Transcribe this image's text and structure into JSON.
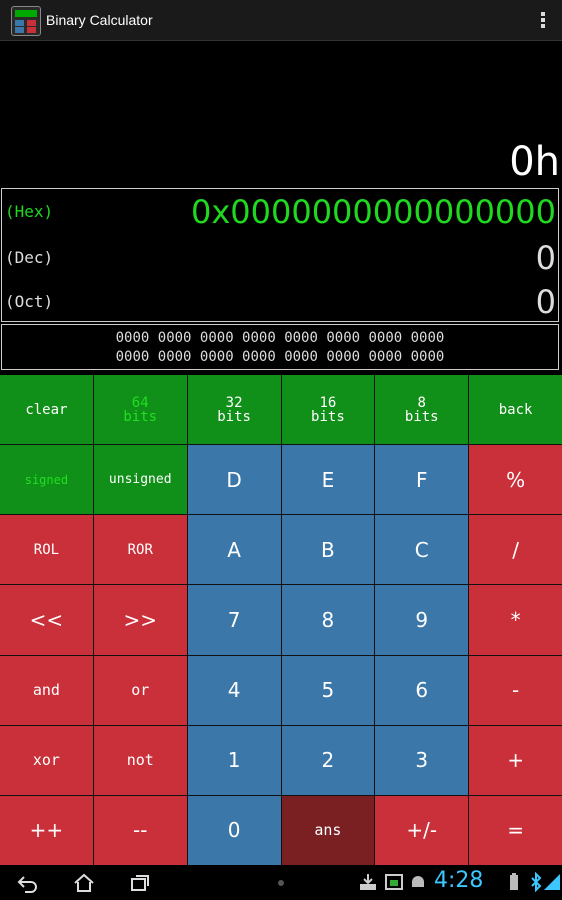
{
  "app": {
    "title": "Binary Calculator",
    "icon": "binary-calculator-app-icon"
  },
  "display": {
    "answer": "0h",
    "hex_label": "(Hex)",
    "hex_value": "0x0000000000000000",
    "dec_label": "(Dec)",
    "dec_value": "0",
    "oct_label": "(Oct)",
    "oct_value": "0",
    "bits_line1": "0000 0000 0000 0000 0000 0000 0000 0000",
    "bits_line2": "0000 0000 0000 0000 0000 0000 0000 0000"
  },
  "keys": {
    "clear": "clear",
    "b64_top": "64",
    "b64_bottom": "bits",
    "b32_top": "32",
    "b32_bottom": "bits",
    "b16_top": "16",
    "b16_bottom": "bits",
    "b8_top": "8",
    "b8_bottom": "bits",
    "back": "back",
    "signed": "signed",
    "unsigned": "unsigned",
    "D": "D",
    "E": "E",
    "F": "F",
    "mod": "%",
    "rol": "ROL",
    "ror": "ROR",
    "A": "A",
    "B": "B",
    "C": "C",
    "div": "/",
    "shl": "<<",
    "shr": ">>",
    "n7": "7",
    "n8": "8",
    "n9": "9",
    "mul": "*",
    "and": "and",
    "or": "or",
    "n4": "4",
    "n5": "5",
    "n6": "6",
    "sub": "-",
    "xor": "xor",
    "not": "not",
    "n1": "1",
    "n2": "2",
    "n3": "3",
    "add": "+",
    "inc": "++",
    "dec": "--",
    "n0": "0",
    "ans": "ans",
    "neg": "+/-",
    "eq": "="
  },
  "status": {
    "clock": "4:28"
  },
  "colors": {
    "green": "#119019",
    "red": "#c93039",
    "blue": "#3b77a8",
    "dark_red": "#7a1f22",
    "hex_text": "#1fd81f",
    "clock": "#3cc7ff"
  }
}
